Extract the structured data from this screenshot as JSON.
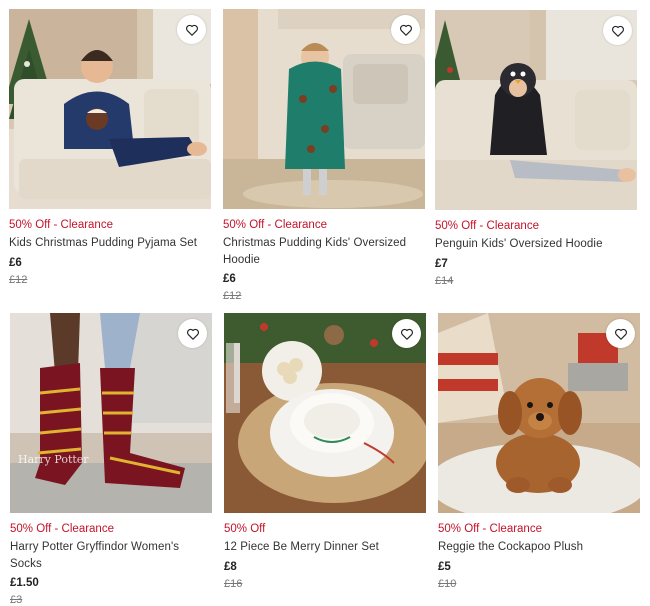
{
  "products": [
    {
      "badge": "50% Off - Clearance",
      "title": "Kids Christmas Pudding Pyjama Set",
      "price": "£6",
      "was_price": "£12",
      "image_icon": "kids-pudding-pyjama-photo",
      "wishlist_icon": "heart-icon"
    },
    {
      "badge": "50% Off - Clearance",
      "title": "Christmas Pudding Kids' Oversized Hoodie",
      "price": "£6",
      "was_price": "£12",
      "image_icon": "pudding-hoodie-photo",
      "wishlist_icon": "heart-icon"
    },
    {
      "badge": "50% Off - Clearance",
      "title": "Penguin Kids' Oversized Hoodie",
      "price": "£7",
      "was_price": "£14",
      "image_icon": "penguin-hoodie-photo",
      "wishlist_icon": "heart-icon"
    },
    {
      "badge": "50% Off - Clearance",
      "title": "Harry Potter Gryffindor Women's Socks",
      "price": "£1.50",
      "was_price": "£3",
      "image_icon": "gryffindor-socks-photo",
      "wishlist_icon": "heart-icon"
    },
    {
      "badge": "50% Off",
      "title": "12 Piece Be Merry Dinner Set",
      "price": "£8",
      "was_price": "£16",
      "image_icon": "dinner-set-photo",
      "wishlist_icon": "heart-icon"
    },
    {
      "badge": "50% Off - Clearance",
      "title": "Reggie the Cockapoo Plush",
      "price": "£5",
      "was_price": "£10",
      "image_icon": "cockapoo-plush-photo",
      "wishlist_icon": "heart-icon"
    }
  ],
  "colors": {
    "badge_red": "#c4132a",
    "text": "#333333",
    "strike": "#777777"
  }
}
